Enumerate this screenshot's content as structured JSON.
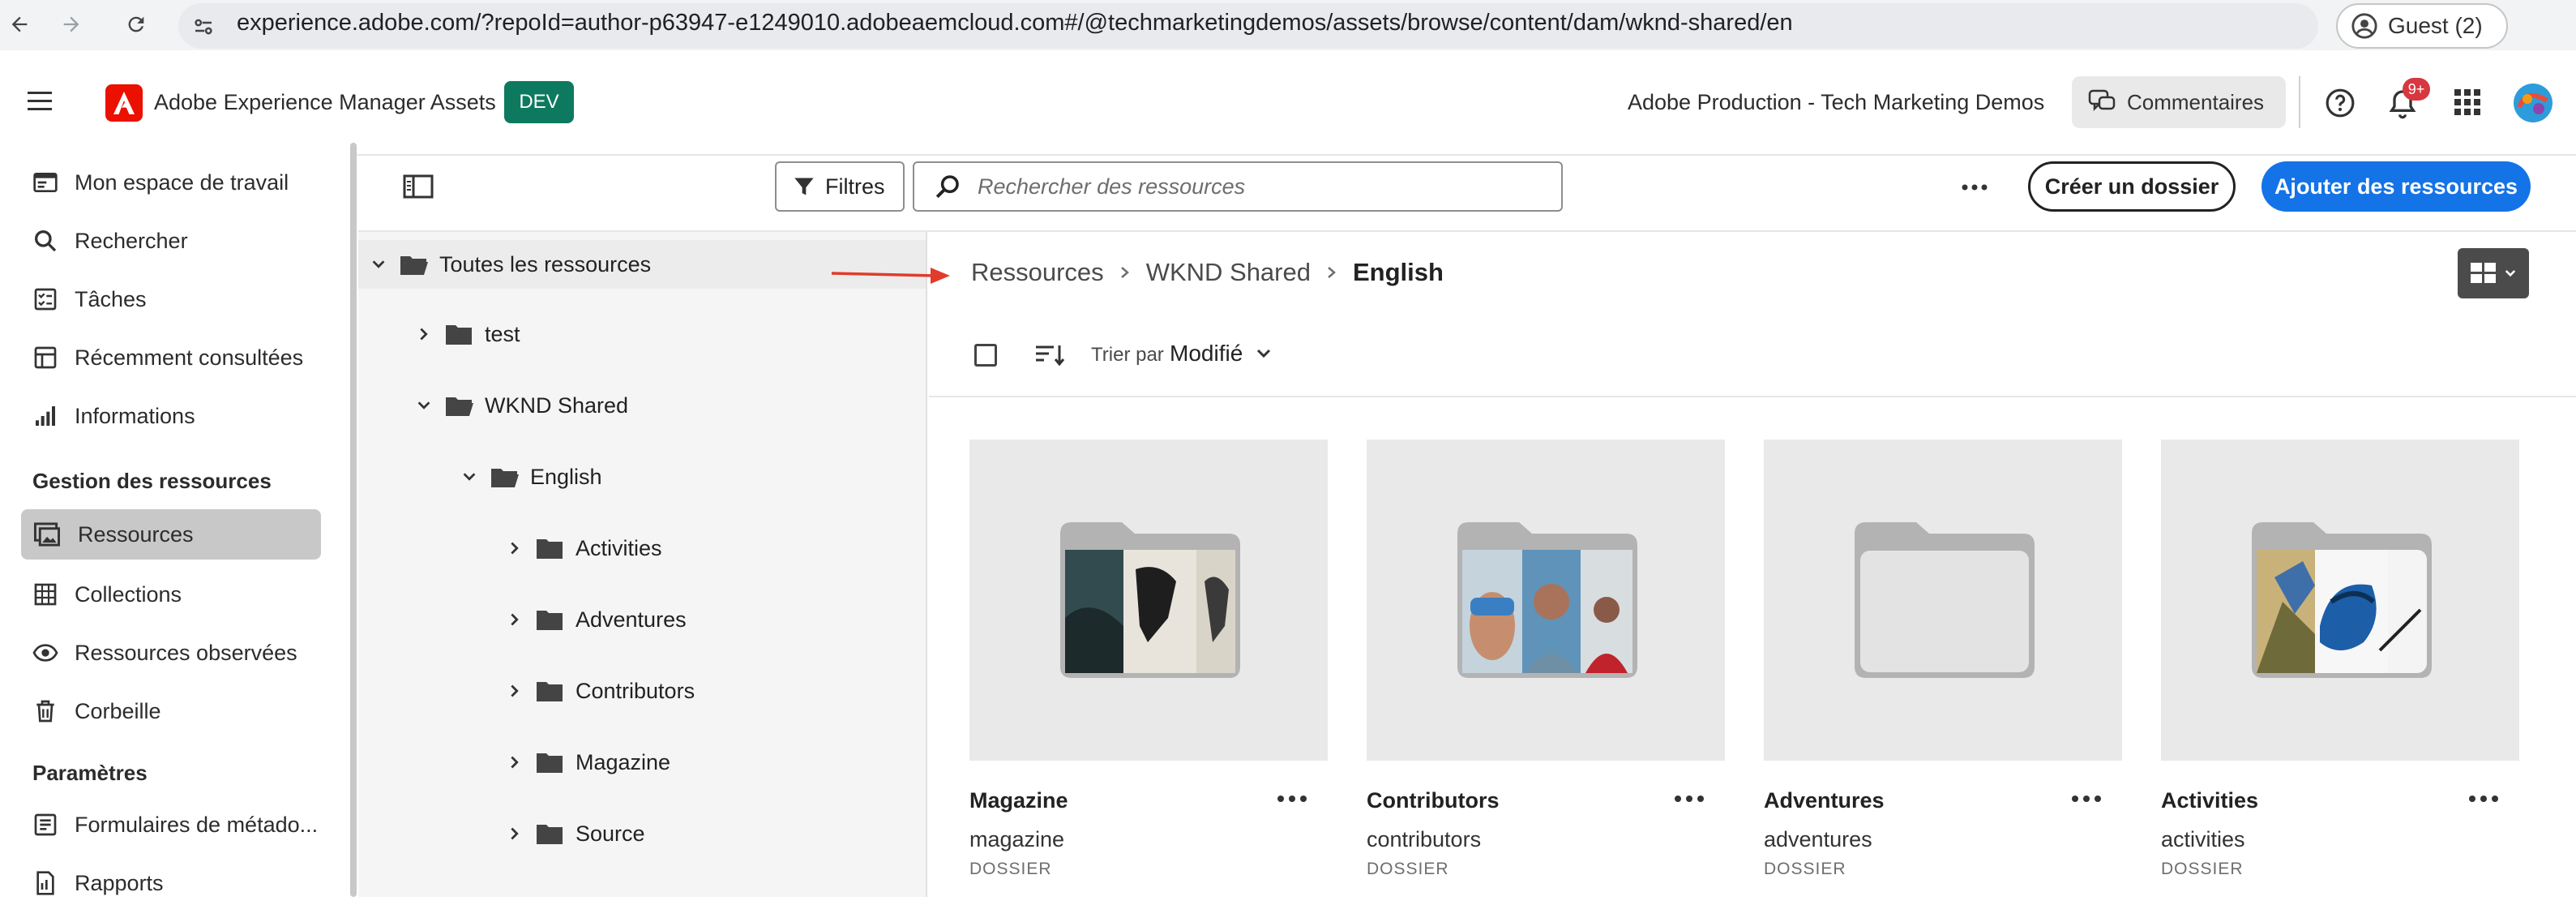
{
  "browser": {
    "url": "experience.adobe.com/?repoId=author-p63947-e1249010.adobeaemcloud.com#/@techmarketingdemos/assets/browse/content/dam/wknd-shared/en",
    "profile_label": "Guest (2)"
  },
  "header": {
    "app_title": "Adobe Experience Manager Assets",
    "env_badge": "DEV",
    "org_name": "Adobe Production - Tech Marketing Demos",
    "comments_label": "Commentaires",
    "notification_count": "9+"
  },
  "sidebar": {
    "items": [
      {
        "label": "Mon espace de travail",
        "icon": "workspace-icon"
      },
      {
        "label": "Rechercher",
        "icon": "search-icon"
      },
      {
        "label": "Tâches",
        "icon": "tasks-icon"
      },
      {
        "label": "Récemment consultées",
        "icon": "recent-icon"
      },
      {
        "label": "Informations",
        "icon": "insights-icon"
      }
    ],
    "section_assets": "Gestion des ressources",
    "asset_items": [
      {
        "label": "Ressources",
        "icon": "assets-icon",
        "active": true
      },
      {
        "label": "Collections",
        "icon": "collections-icon"
      },
      {
        "label": "Ressources observées",
        "icon": "watched-icon"
      },
      {
        "label": "Corbeille",
        "icon": "trash-icon"
      }
    ],
    "section_settings": "Paramètres",
    "settings_items": [
      {
        "label": "Formulaires de métado...",
        "icon": "metadata-forms-icon"
      },
      {
        "label": "Rapports",
        "icon": "reports-icon"
      }
    ]
  },
  "toolbar": {
    "filters_label": "Filtres",
    "search_placeholder": "Rechercher des ressources",
    "create_folder_label": "Créer un dossier",
    "add_assets_label": "Ajouter des ressources"
  },
  "tree": {
    "root": "Toutes les ressources",
    "nodes": [
      {
        "label": "test",
        "level": 1,
        "expanded": false
      },
      {
        "label": "WKND Shared",
        "level": 1,
        "expanded": true
      },
      {
        "label": "English",
        "level": 2,
        "expanded": true
      },
      {
        "label": "Activities",
        "level": 3,
        "expanded": false
      },
      {
        "label": "Adventures",
        "level": 3,
        "expanded": false
      },
      {
        "label": "Contributors",
        "level": 3,
        "expanded": false
      },
      {
        "label": "Magazine",
        "level": 3,
        "expanded": false
      },
      {
        "label": "Source",
        "level": 3,
        "expanded": false
      }
    ]
  },
  "breadcrumb": [
    "Ressources",
    "WKND Shared",
    "English"
  ],
  "sort": {
    "label": "Trier par",
    "value": "Modifié"
  },
  "cards": [
    {
      "title": "Magazine",
      "name": "magazine",
      "type": "DOSSIER"
    },
    {
      "title": "Contributors",
      "name": "contributors",
      "type": "DOSSIER"
    },
    {
      "title": "Adventures",
      "name": "adventures",
      "type": "DOSSIER"
    },
    {
      "title": "Activities",
      "name": "activities",
      "type": "DOSSIER"
    }
  ],
  "colors": {
    "accent": "#1473e6",
    "adobe_red": "#eb1000",
    "dev_badge": "#0d7a5f",
    "arrow": "#e03c2b"
  }
}
